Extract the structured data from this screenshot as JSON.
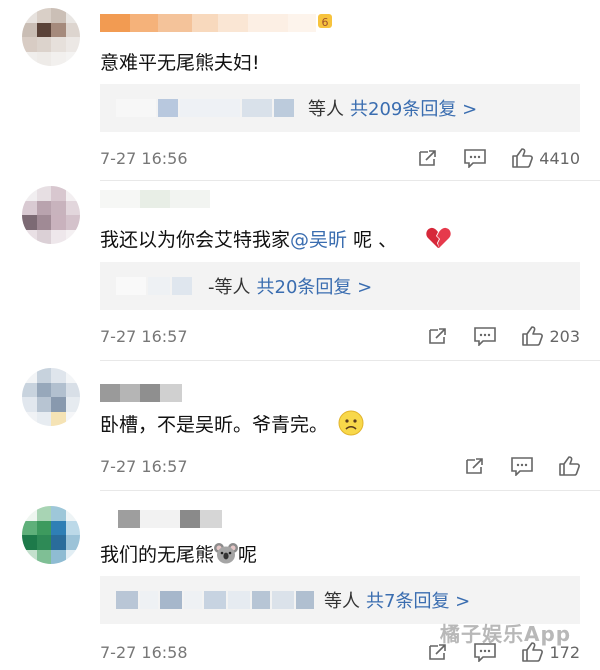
{
  "comments": [
    {
      "text": "意难平无尾熊夫妇!",
      "reply": {
        "prefix": "等人",
        "count_label": "共209条回复 >"
      },
      "time": "7-27 16:56",
      "likes": "4410"
    },
    {
      "text_prefix": "我还以为你会艾特我家",
      "mention": "@吴昕",
      "text_suffix": "呢 、",
      "emoji": "broken-heart",
      "reply": {
        "prefix": "-等人",
        "count_label": "共20条回复 >"
      },
      "time": "7-27 16:57",
      "likes": "203"
    },
    {
      "text": "卧槽，不是吴昕。爷青完。",
      "emoji": "worried-face",
      "time": "7-27 16:57",
      "likes": ""
    },
    {
      "text_prefix": "我们的无尾熊",
      "emoji": "koala",
      "text_suffix": "呢",
      "reply": {
        "prefix": "等人",
        "count_label": "共7条回复 >"
      },
      "time": "7-27 16:58",
      "likes": "172"
    }
  ],
  "watermark": "橘子娱乐App",
  "colors": {
    "link": "#3a6db0",
    "meta": "#777777",
    "reply_bg": "#f3f3f3",
    "divider": "#e8e8e8"
  },
  "icons": [
    "share-icon",
    "comment-icon",
    "like-icon"
  ]
}
